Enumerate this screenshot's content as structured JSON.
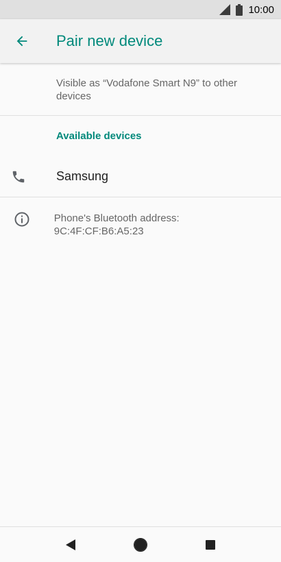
{
  "status_bar": {
    "time": "10:00",
    "icons": [
      "signal-icon",
      "battery-icon"
    ]
  },
  "app_bar": {
    "title": "Pair new device",
    "back_icon": "arrow-back-icon"
  },
  "visibility": {
    "text": "Visible as “Vodafone Smart N9” to other devices"
  },
  "available_devices": {
    "header": "Available devices",
    "devices": [
      {
        "name": "Samsung",
        "icon": "phone-icon"
      }
    ]
  },
  "info": {
    "icon": "info-icon",
    "text": "Phone's Bluetooth address: 9C:4F:CF:B6:A5:23"
  },
  "nav_bar": {
    "buttons": [
      "back-triangle-icon",
      "home-circle-icon",
      "recents-square-icon"
    ]
  },
  "colors": {
    "accent": "#00897b",
    "status_bar_bg": "#e0e0e0",
    "app_bar_bg": "#f2f2f2",
    "secondary_text": "#666666",
    "primary_text": "#212121",
    "icon": "#5f6368"
  }
}
